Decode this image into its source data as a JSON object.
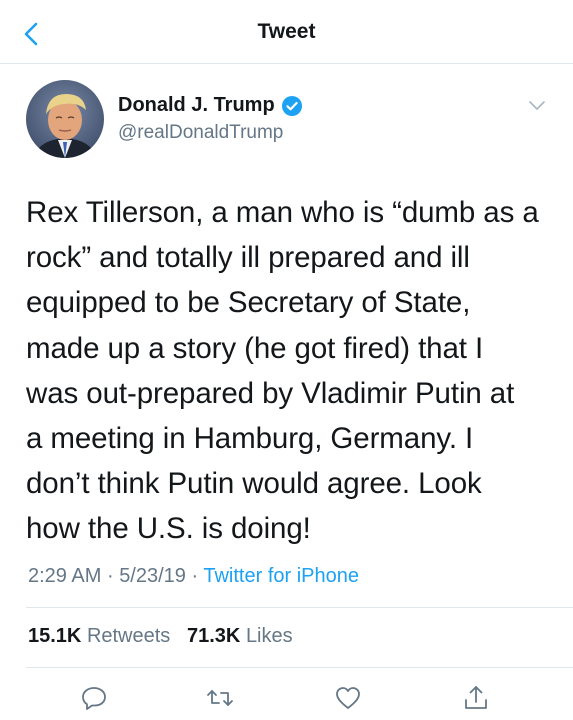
{
  "nav": {
    "title": "Tweet",
    "back_icon": "chevron-left-icon"
  },
  "author": {
    "name": "Donald J. Trump",
    "handle": "@realDonaldTrump",
    "verified": true
  },
  "tweet": {
    "text": "Rex Tillerson, a man who is “dumb as a rock” and totally ill prepared and ill equipped to be Secretary of State, made up a story (he got fired) that I was out-prepared by Vladimir Putin at a meeting in Hamburg, Germany. I don’t think Putin would agree. Look how the U.S. is doing!",
    "lines": [
      "Rex Tillerson, a man who is “dumb as a",
      "rock” and totally ill prepared and ill",
      "equipped to be Secretary of State,",
      "made up a story (he got fired) that I",
      "was out-prepared by Vladimir Putin at",
      "a meeting in Hamburg, Germany. I",
      "don’t think Putin would agree. Look",
      "how the U.S. is doing!"
    ],
    "time": "2:29 AM",
    "date": "5/23/19",
    "separator": "·",
    "source": "Twitter for iPhone"
  },
  "stats": {
    "retweets_count": "15.1K",
    "retweets_label": "Retweets",
    "likes_count": "71.3K",
    "likes_label": "Likes"
  },
  "actions": [
    "reply-icon",
    "retweet-icon",
    "like-icon",
    "share-icon"
  ],
  "colors": {
    "accent": "#1da1f2",
    "text": "#14171a",
    "secondary": "#657786",
    "divider": "#e1e8ed"
  }
}
